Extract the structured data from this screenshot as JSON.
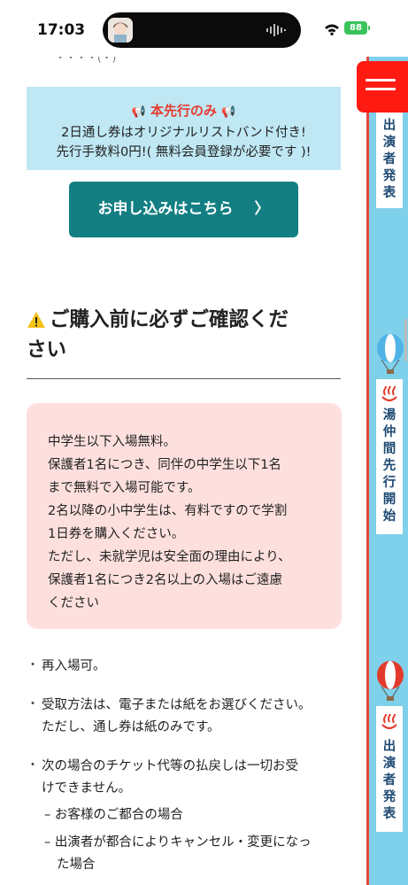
{
  "status_bar": {
    "time": "17:03",
    "battery": "88"
  },
  "top_partial_text": "・・・・(・)",
  "notice": {
    "title": "本先行のみ",
    "line1": "2日通し券はオリジナルリストバンド付き!",
    "line2": "先行手数料0円!( 無料会員登録が必要です )!"
  },
  "apply_button": {
    "label": "お申し込みはこちら",
    "chevron": "〉"
  },
  "section": {
    "heading_line1": "ご購入前に必ずご確認くだ",
    "heading_line2": "さい"
  },
  "pink_notice": {
    "lines": [
      "中学生以下入場無料。",
      "保護者1名につき、同伴の中学生以下1名",
      "まで無料で入場可能です。",
      "2名以降の小中学生は、有料ですので学割",
      "1日券を購入ください。",
      "ただし、未就学児は安全面の理由により、",
      "保護者1名につき2名以上の入場はご遠慮",
      "ください"
    ]
  },
  "bullets": {
    "item1": "再入場可。",
    "item2_line1": "受取方法は、電子または紙をお選びください。",
    "item2_line2": "ただし、通し券は紙のみです。",
    "item3_line1": "次の場合のチケット代等の払戻しは一切お受",
    "item3_line2": "けできません。",
    "sub1": "お客様のご都合の場合",
    "sub2_line1": "出演者が都合によりキャンセル・変更になっ",
    "sub2_line2": "た場合",
    "dot": "・",
    "dash": "–"
  },
  "sidebar": {
    "tab1": [
      "出",
      "演",
      "者",
      "発",
      "表"
    ],
    "tab2": [
      "湯",
      "仲",
      "間",
      "先",
      "行",
      "開",
      "始"
    ],
    "tab3": [
      "出",
      "演",
      "者",
      "発",
      "表"
    ]
  },
  "colors": {
    "accent_teal": "#137f83",
    "notice_blue": "#bfe8f4",
    "notice_red": "#e83a2f",
    "pink_bg": "#fde0de",
    "sidebar_blue": "#7fd0ea",
    "menu_red": "#ff1a12"
  },
  "icons": [
    "megaphone-icon",
    "warning-icon",
    "hot-spring-icon",
    "balloon-icon",
    "menu-icon",
    "wifi-icon"
  ]
}
